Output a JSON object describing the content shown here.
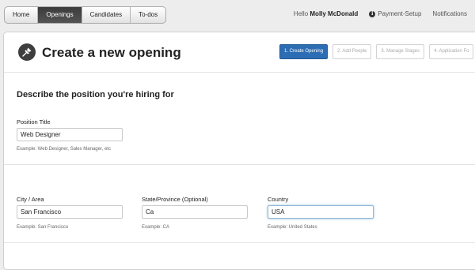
{
  "nav": {
    "tabs": [
      {
        "label": "Home",
        "active": false
      },
      {
        "label": "Openings",
        "active": true
      },
      {
        "label": "Candidates",
        "active": false
      },
      {
        "label": "To-dos",
        "active": false
      }
    ],
    "greeting": "Hello",
    "user_name": "Molly McDonald",
    "payment_setup": "Payment-Setup",
    "notifications": "Notifications",
    "info_icon": "info-icon"
  },
  "page": {
    "icon": "pushpin-icon",
    "title": "Create a new opening",
    "steps": [
      "1. Create Opening",
      "2. Add People",
      "3. Manage Stages",
      "4. Application Fo"
    ],
    "active_step": 0,
    "accent_color": "#2d6db3"
  },
  "form": {
    "heading": "Describe the position you're hiring for",
    "position": {
      "label": "Position Title",
      "value": "Web Designer",
      "hint": "Example: Web Designer, Sales Manager, etc"
    },
    "city": {
      "label": "City / Area",
      "value": "San Francisco",
      "hint": "Example: San Francisco"
    },
    "state": {
      "label": "State/Province (Optional)",
      "value": "Ca",
      "hint": "Example: CA"
    },
    "country": {
      "label": "Country",
      "value": "USA",
      "hint": "Example: United States",
      "focused": true
    }
  }
}
